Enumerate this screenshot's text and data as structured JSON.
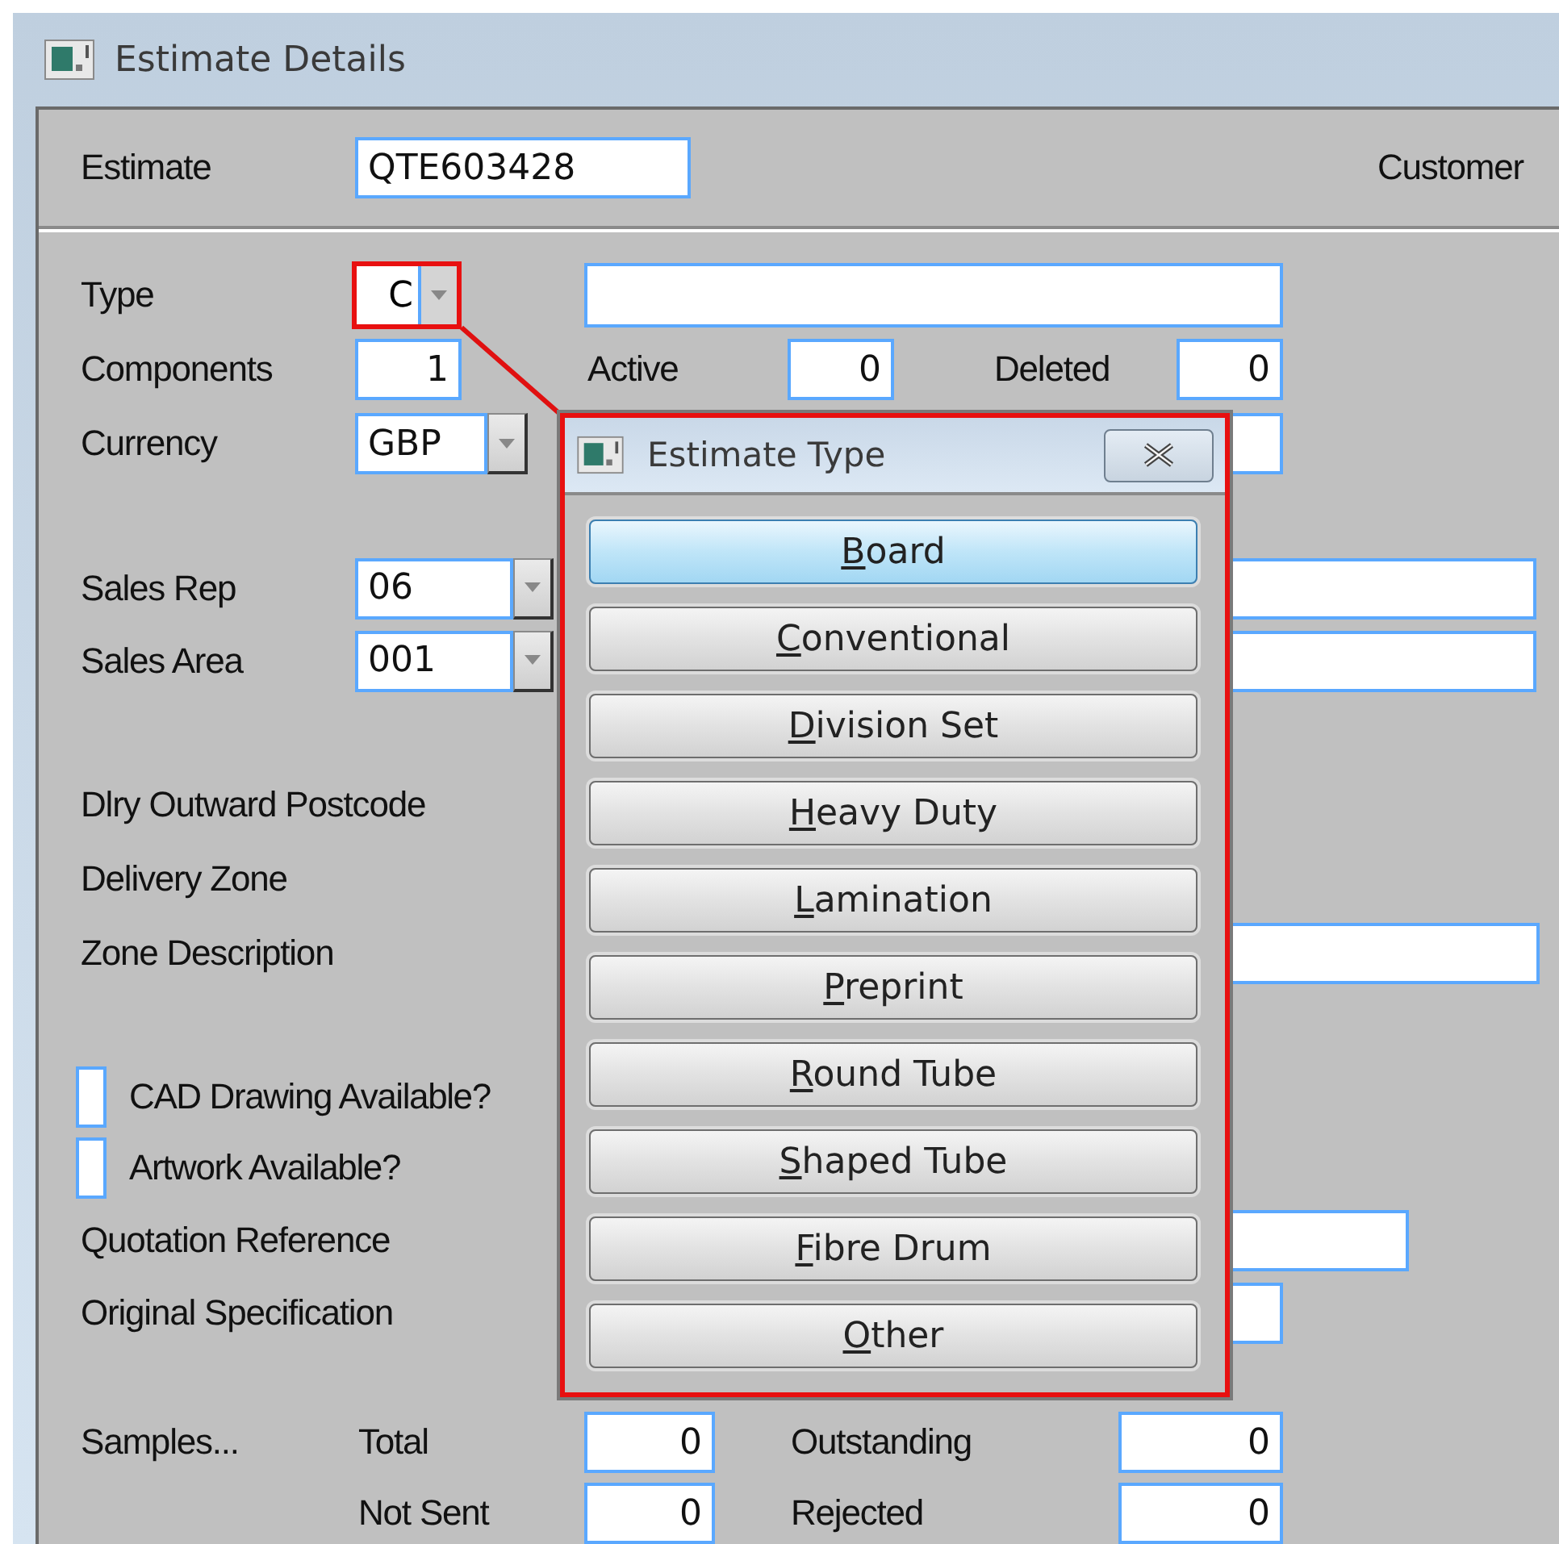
{
  "window": {
    "title": "Estimate Details"
  },
  "header": {
    "estimate_label": "Estimate",
    "estimate": "QTE603428",
    "customer_label": "Customer"
  },
  "type": {
    "label": "Type",
    "value": "C"
  },
  "counts": [
    {
      "label": "Components",
      "value": "1"
    },
    {
      "label": "Active",
      "value": "0"
    },
    {
      "label": "Deleted",
      "value": "0"
    }
  ],
  "currency": {
    "label": "Currency",
    "value": "GBP"
  },
  "sales_rep": {
    "label": "Sales Rep",
    "value": "06"
  },
  "sales_area": {
    "label": "Sales Area",
    "value": "001"
  },
  "delivery": [
    "Dlry Outward Postcode",
    "Delivery Zone",
    "Zone Description"
  ],
  "checkboxes": [
    {
      "label": "CAD Drawing Available?",
      "checked": false
    },
    {
      "label": "Artwork Available?",
      "checked": false
    }
  ],
  "references": [
    "Quotation Reference",
    "Original Specification"
  ],
  "samples": {
    "label": "Samples...",
    "counts": [
      {
        "label": "Total",
        "value": "0"
      },
      {
        "label": "Outstanding",
        "value": "0"
      },
      {
        "label": "Not Sent",
        "value": "0"
      },
      {
        "label": "Rejected",
        "value": "0"
      }
    ]
  },
  "dialog": {
    "title": "Estimate Type",
    "options": [
      {
        "label": "Board",
        "selected": true
      },
      {
        "label": "Conventional",
        "selected": false
      },
      {
        "label": "Division Set",
        "selected": false
      },
      {
        "label": "Heavy Duty",
        "selected": false
      },
      {
        "label": "Lamination",
        "selected": false
      },
      {
        "label": "Preprint",
        "selected": false
      },
      {
        "label": "Round Tube",
        "selected": false
      },
      {
        "label": "Shaped Tube",
        "selected": false
      },
      {
        "label": "Fibre Drum",
        "selected": false
      },
      {
        "label": "Other",
        "selected": false
      }
    ]
  }
}
